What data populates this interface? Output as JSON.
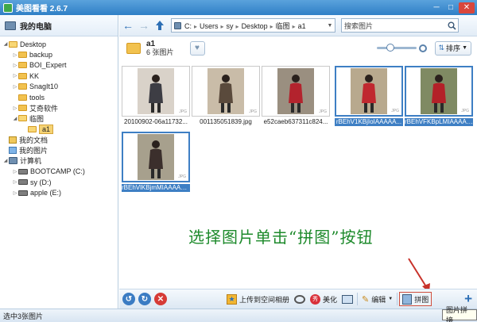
{
  "window": {
    "title": "美图看看 2.6.7",
    "buttons": [
      "─",
      "□",
      "✕"
    ]
  },
  "sidebar": {
    "header": "我的电脑",
    "tree": [
      {
        "label": "Desktop",
        "indent": 0,
        "type": "folder-open",
        "tri": "◢"
      },
      {
        "label": "backup",
        "indent": 1,
        "type": "folder",
        "tri": "▷"
      },
      {
        "label": "BOI_Expert",
        "indent": 1,
        "type": "folder",
        "tri": "▷"
      },
      {
        "label": "KK",
        "indent": 1,
        "type": "folder",
        "tri": "▷"
      },
      {
        "label": "SnagIt10",
        "indent": 1,
        "type": "folder",
        "tri": "▷"
      },
      {
        "label": "tools",
        "indent": 1,
        "type": "folder",
        "tri": ""
      },
      {
        "label": "艾奇软件",
        "indent": 1,
        "type": "folder",
        "tri": "▷"
      },
      {
        "label": "临图",
        "indent": 1,
        "type": "folder-open",
        "tri": "◢"
      },
      {
        "label": "a1",
        "indent": 2,
        "type": "folder-open",
        "tri": "",
        "selected": true
      },
      {
        "label": "我的文档",
        "indent": 0,
        "type": "doc",
        "tri": ""
      },
      {
        "label": "我的图片",
        "indent": 0,
        "type": "pic",
        "tri": ""
      },
      {
        "label": "计算机",
        "indent": 0,
        "type": "computer",
        "tri": "◢"
      },
      {
        "label": "BOOTCAMP (C:)",
        "indent": 1,
        "type": "drive",
        "tri": "▷"
      },
      {
        "label": "sy (D:)",
        "indent": 1,
        "type": "drive",
        "tri": "▷"
      },
      {
        "label": "apple (E:)",
        "indent": 1,
        "type": "drive",
        "tri": "▷"
      }
    ]
  },
  "toolbar": {
    "breadcrumb": [
      "C:",
      "Users",
      "sy",
      "Desktop",
      "临图",
      "a1"
    ],
    "search_placeholder": "搜索图片"
  },
  "folder": {
    "name": "a1",
    "count": "6 张图片"
  },
  "sort_label": "排序",
  "zoom_level": 0.3,
  "thumbnails": [
    {
      "caption": "20100902-06a11732...",
      "selected": false,
      "bg": "#d9d2c9",
      "fig": "#3d3d44"
    },
    {
      "caption": "001135051839.jpg",
      "selected": false,
      "bg": "#c9bca8",
      "fig": "#5a4a3c"
    },
    {
      "caption": "e52caeb637311c824...",
      "selected": false,
      "bg": "#9a8f80",
      "fig": "#b3232d"
    },
    {
      "caption": "rBEhV1KBjIoIAAAAA...",
      "selected": true,
      "bg": "#b8a98e",
      "fig": "#c0282f"
    },
    {
      "caption": "rBEhVFKBpLMIAAAAA...",
      "selected": true,
      "bg": "#7f8a63",
      "fig": "#b32128"
    },
    {
      "caption": "rBEhVlKBjmMIAAAAA...",
      "selected": true,
      "bg": "#a7a08d",
      "fig": "#3b2f2c"
    }
  ],
  "thumb_ext": "JPG",
  "instruction": "选择图片单击“拼图”按钮",
  "bottom_toolbar": {
    "upload": "上传到空间相册",
    "beautify": "美化",
    "edit": "编辑",
    "collage": "拼图"
  },
  "status": "选中3张图片",
  "tooltip": "图片拼接",
  "colors": {
    "accent": "#3e7fc4",
    "instruction_green": "#1d8a2b",
    "arrow_red": "#c8322a"
  }
}
